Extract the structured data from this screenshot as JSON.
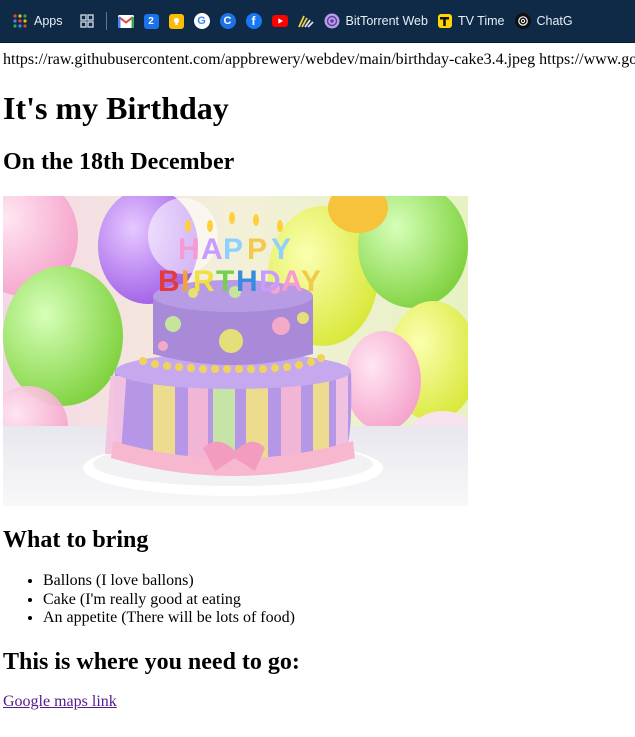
{
  "bookmarks": [
    {
      "label": "Apps",
      "icon": "apps-grid-icon"
    },
    {
      "label": "",
      "icon": "app-launcher-icon"
    },
    {
      "label": "",
      "icon": "gmail-icon"
    },
    {
      "label": "2",
      "icon": "calendar-icon"
    },
    {
      "label": "",
      "icon": "keep-icon"
    },
    {
      "label": "G",
      "icon": "google-icon"
    },
    {
      "label": "C",
      "icon": "c-logo-icon"
    },
    {
      "label": "f",
      "icon": "facebook-icon"
    },
    {
      "label": "",
      "icon": "youtube-icon"
    },
    {
      "label": "",
      "icon": "bars-logo-icon"
    },
    {
      "label": "BitTorrent Web",
      "icon": "bittorrent-icon"
    },
    {
      "label": "TV Time",
      "icon": "tvtime-icon"
    },
    {
      "label": "ChatG",
      "icon": "chatgpt-icon"
    }
  ],
  "page": {
    "url_text": "https://raw.githubusercontent.com/appbrewery/webdev/main/birthday-cake3.4.jpeg https://www.go",
    "title": "It's my Birthday",
    "date_heading": "On the 18th December",
    "image_caption": "HAPPY BIRTHDAY",
    "bring_heading": "What to bring",
    "bring_items": [
      "Ballons (I love ballons)",
      "Cake (I'm really good at eating",
      "An appetite (There will be lots of food)"
    ],
    "where_heading": "This is where you need to go:",
    "maps_link": "Google maps link"
  },
  "colors": {
    "bookmark_bar": "#0e2a47",
    "visited_link": "#551a8b"
  }
}
